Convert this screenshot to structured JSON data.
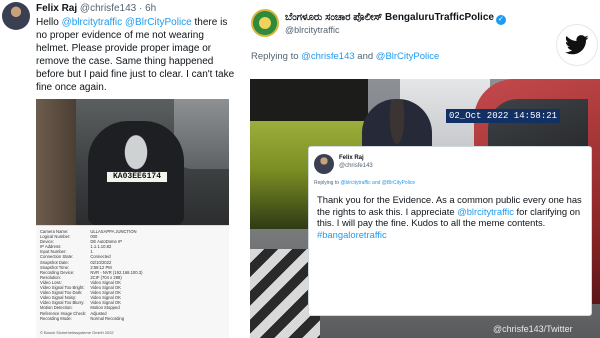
{
  "left_tweet": {
    "author_name": "Felix Raj",
    "author_meta": "@chrisfe143 · 6h",
    "text_part1": "Hello ",
    "mention1": "@blrcitytraffic",
    "mention2": "@BlrCityPolice",
    "text_part2": "there is no proper evidence of me not wearing helmet.  Please provide proper image or remove the case.   Same thing happened before but I paid fine just to clear. I can't take fine once again.",
    "plate": "KA03EE6174",
    "report_rows": [
      [
        "Camera Name:",
        "ULLASAPPA JUNCTION"
      ],
      [
        "Logical Number:",
        "000"
      ],
      [
        "Device:",
        "DE AutoDome IP"
      ],
      [
        "IP Address:",
        "1.1.1.10.82"
      ],
      [
        "Input Number:",
        "1"
      ],
      [
        "Connection State:",
        "Connected"
      ],
      [
        "Snapshot Date:",
        "02/10/2022"
      ],
      [
        "Snapshot Time:",
        "2:58:12 PM"
      ],
      [
        "Recording Device:",
        "NVR - NVR (192.168.100.3)"
      ],
      [
        "Resolution:",
        "2CIF (704 x 288)"
      ],
      [
        "Video Loss:",
        "Video Signal OK"
      ],
      [
        "Video Signal Too Bright:",
        "Video Signal OK"
      ],
      [
        "Video Signal Too Dark:",
        "Video Signal OK"
      ],
      [
        "Video Signal Noisy:",
        "Video Signal OK"
      ],
      [
        "Video Signal Too Blurry:",
        "Video Signal OK"
      ],
      [
        "Motion Detection:",
        "Motion Stopped"
      ],
      [
        "Reference Image Check:",
        "Adjusted"
      ],
      [
        "Recording Mode:",
        "Normal Recording"
      ]
    ],
    "report_footer": "© Bosch Sicherheitssysteme GmbH 2022"
  },
  "right_tweet": {
    "account_name": "ಬೆಂಗಳೂರು ಸಂಚಾರ ಪೊಲೀಸ್ BengaluruTrafficPolice",
    "account_handle": "@blrcitytraffic",
    "verified_glyph": "✓",
    "replying_prefix": "Replying to ",
    "replying_mention1": "@chrisfe143",
    "replying_and": " and ",
    "replying_mention2": "@BlrCityPolice",
    "timestamp": "02_Oct 2022  14:58:21"
  },
  "embedded_reply": {
    "author_name": "Felix Raj",
    "author_handle": "@chrisfe143",
    "replying_prefix": "Replying to ",
    "replying_mentions": "@blrcitytraffic and @BlrCityPolice",
    "text_part1": "Thank you for the Evidence.  As a common public every one has the rights to ask this.  I appreciate ",
    "mention": "@blrcitytraffic",
    "text_part2": " for clarifying on this. I will pay the fine. Kudos to all the meme contents. ",
    "hashtag": "#bangaloretraffic"
  },
  "credit": "@chrisfe143/Twitter",
  "colors": {
    "link": "#1d9bf0",
    "text": "#0f1419",
    "muted": "#536471",
    "stamp_bg": "#123063"
  },
  "icons": {
    "brand": "twitter-bird-icon",
    "verified": "verified-badge-icon"
  }
}
